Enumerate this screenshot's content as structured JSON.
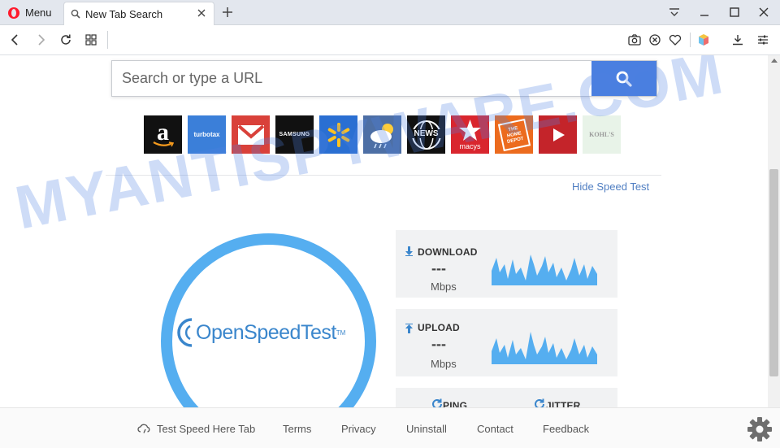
{
  "browser": {
    "menu_label": "Menu",
    "tab_title": "New Tab Search",
    "brand_color": "#ff1b2d"
  },
  "search": {
    "placeholder": "Search or type a URL",
    "button_color": "#4a7fe0",
    "button_icon": "search-icon"
  },
  "tiles": [
    {
      "name": "amazon",
      "label": "a"
    },
    {
      "name": "turbotax",
      "label": "turbotax"
    },
    {
      "name": "gmail",
      "label": "M"
    },
    {
      "name": "samsung",
      "label": "SAMSUNG"
    },
    {
      "name": "walmart",
      "label": ""
    },
    {
      "name": "weather",
      "label": ""
    },
    {
      "name": "news",
      "label": "NEWS"
    },
    {
      "name": "macys",
      "label": "macys"
    },
    {
      "name": "home-depot",
      "label": "THE HOME DEPOT"
    },
    {
      "name": "youtube",
      "label": ""
    },
    {
      "name": "kohls",
      "label": "KOHL'S"
    }
  ],
  "speedtest": {
    "hide_label": "Hide Speed Test",
    "logo_text": "OpenSpeedTest",
    "logo_tm": "TM",
    "download": {
      "label": "DOWNLOAD",
      "value": "---",
      "unit": "Mbps"
    },
    "upload": {
      "label": "UPLOAD",
      "value": "---",
      "unit": "Mbps"
    },
    "ping": {
      "label": "PING"
    },
    "jitter": {
      "label": "JITTER"
    },
    "accent_color": "#55aef0"
  },
  "watermark": "MYANTISPYWARE.COM",
  "footer": {
    "links": [
      "Test Speed Here Tab",
      "Terms",
      "Privacy",
      "Uninstall",
      "Contact",
      "Feedback"
    ]
  }
}
